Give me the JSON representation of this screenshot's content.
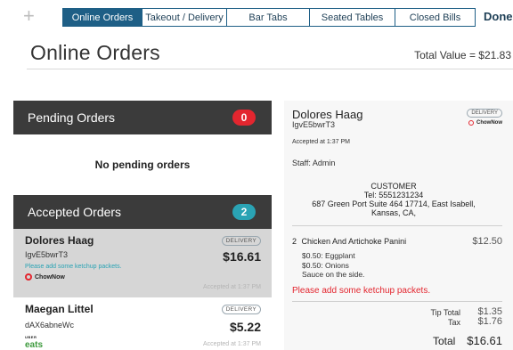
{
  "toolbar": {
    "add_icon": "plus-icon",
    "tabs": [
      {
        "label": "Online Orders",
        "active": true
      },
      {
        "label": "Takeout / Delivery",
        "active": false
      },
      {
        "label": "Bar Tabs",
        "active": false
      },
      {
        "label": "Seated Tables",
        "active": false
      },
      {
        "label": "Closed Bills",
        "active": false
      }
    ],
    "done_label": "Done"
  },
  "page": {
    "title": "Online Orders",
    "total_value": "Total Value = $21.83"
  },
  "pending": {
    "title": "Pending Orders",
    "count": "0",
    "empty_text": "No pending orders"
  },
  "accepted": {
    "title": "Accepted Orders",
    "count": "2",
    "orders": [
      {
        "name": "Dolores Haag",
        "id": "IgvE5bwrT3",
        "note": "Please add some ketchup packets.",
        "type": "DELIVERY",
        "price": "$16.61",
        "source": "ChowNow",
        "accepted": "Accepted at 1:37 PM"
      },
      {
        "name": "Maegan Littel",
        "id": "dAX6abneWc",
        "type": "DELIVERY",
        "price": "$5.22",
        "source_top": "UBER",
        "source": "eats",
        "accepted": "Accepted at 1:37 PM"
      }
    ]
  },
  "receipt": {
    "name": "Dolores Haag",
    "id": "IgvE5bwrT3",
    "type": "DELIVERY",
    "source": "ChowNow",
    "accepted": "Accepted at 1:37 PM",
    "staff": "Staff: Admin",
    "customer_label": "CUSTOMER",
    "customer_tel": "Tel: 5551231234",
    "customer_addr1": "687 Green Port Suite 464 17714, East Isabell,",
    "customer_addr2": "Kansas, CA,",
    "item_qty": "2",
    "item_name": "Chicken And Artichoke Panini",
    "item_price": "$12.50",
    "mod1": "$0.50: Eggplant",
    "mod2": "$0.50: Onions",
    "mod3": "Sauce on the side.",
    "note": "Please add some ketchup packets.",
    "tip_label": "Tip Total",
    "tip_amount": "$1.35",
    "tax_label": "Tax",
    "tax_amount": "$1.76",
    "total_label": "Total",
    "total_amount": "$16.61"
  },
  "colors": {
    "accent": "#1e5f86",
    "alert": "#e3262f",
    "teal": "#2aa3b4",
    "panel_header": "#3b3b3b"
  }
}
